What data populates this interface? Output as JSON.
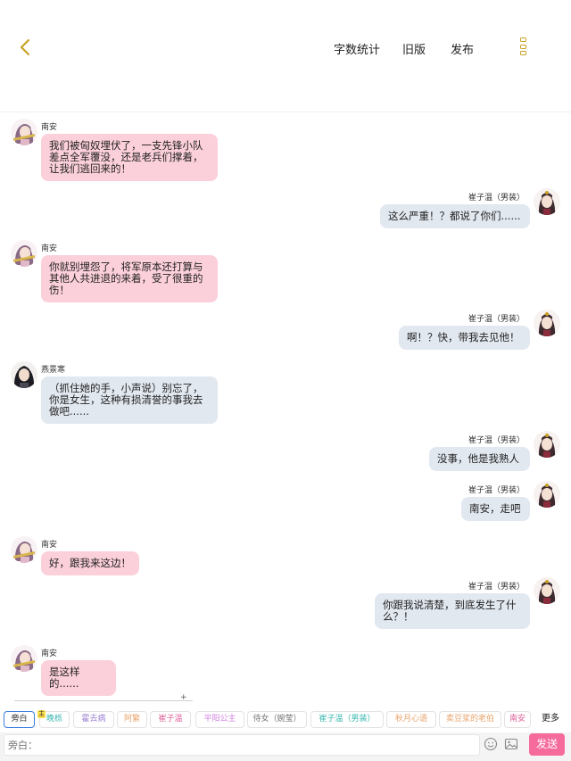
{
  "header": {
    "word_count_label": "字数统计",
    "old_version_label": "旧版",
    "publish_label": "发布"
  },
  "accent_color": "#c9a227",
  "messages": [
    {
      "speaker": "南安",
      "side": "left",
      "color": "pink",
      "lines": [
        "我们被匈奴埋伏了，一支先锋小队",
        "差点全军覆没，还是老兵们撑着，",
        "让我们逃回来的！"
      ]
    },
    {
      "speaker": "崔子温（男装）",
      "side": "right",
      "color": "blue",
      "lines": [
        "这么严重！？都说了你们......"
      ]
    },
    {
      "speaker": "南安",
      "side": "left",
      "color": "pink",
      "lines": [
        "你就别埋怨了，将军原本还打算与",
        "其他人共进退的来着，受了很重的",
        "伤！"
      ]
    },
    {
      "speaker": "崔子温（男装）",
      "side": "right",
      "color": "blue",
      "lines": [
        "啊！？快，带我去见他！"
      ]
    },
    {
      "speaker": "燕景寒",
      "side": "left",
      "color": "blue",
      "lines": [
        "（抓住她的手，小声说）别忘了，",
        "你是女生，这种有损清誉的事我去",
        "做吧......"
      ]
    },
    {
      "speaker": "崔子温（男装）",
      "side": "right",
      "color": "blue",
      "lines": [
        "没事，他是我熟人"
      ]
    },
    {
      "speaker": "崔子温（男装）",
      "side": "right",
      "color": "blue",
      "lines": [
        "南安，走吧"
      ]
    },
    {
      "speaker": "南安",
      "side": "left",
      "color": "pink",
      "lines": [
        "好，跟我来这边！"
      ]
    },
    {
      "speaker": "崔子温（男装）",
      "side": "right",
      "color": "blue",
      "lines": [
        "你跟我说清楚，到底发生了什",
        "么？！"
      ]
    },
    {
      "speaker": "南安",
      "side": "left",
      "color": "pink",
      "lines": [
        "是这样的......"
      ]
    }
  ],
  "divider_end_label": "+",
  "roles": {
    "items": [
      {
        "label": "旁白",
        "color": "#333333"
      },
      {
        "label": "晚栎",
        "color": "#3bb8b0"
      },
      {
        "label": "霍去病",
        "color": "#9a7fd0"
      },
      {
        "label": "阿繁",
        "color": "#e8a36b"
      },
      {
        "label": "崔子温",
        "color": "#e0609a"
      },
      {
        "label": "平阳公主",
        "color": "#d07de0"
      },
      {
        "label": "侍女（婉莹）",
        "color": "#777777"
      },
      {
        "label": "崔子温（男装）",
        "color": "#3bb8b0"
      },
      {
        "label": "秋月心语",
        "color": "#e8a36b"
      },
      {
        "label": "卖豆浆的老伯",
        "color": "#e8a36b"
      },
      {
        "label": "南安",
        "color": "#e0609a"
      }
    ],
    "main_badge": "主",
    "more_label": "更多"
  },
  "input": {
    "placeholder": "旁白："
  },
  "send_label": "发送"
}
